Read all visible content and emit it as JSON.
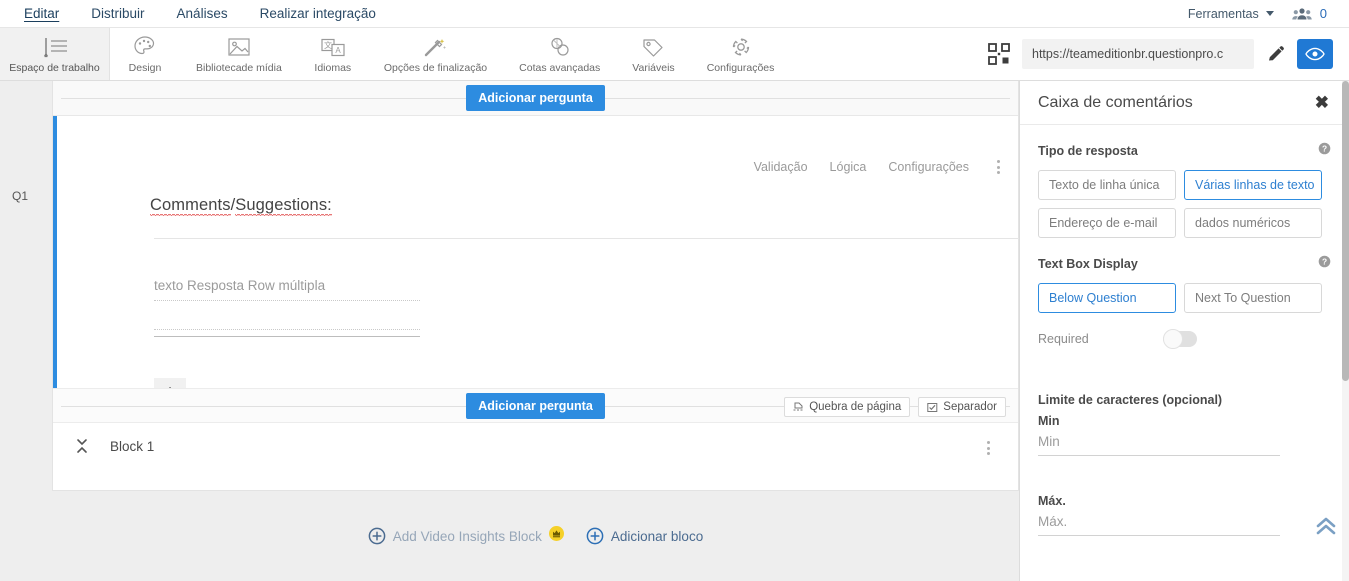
{
  "topnav": {
    "items": [
      {
        "label": "Editar",
        "active": true
      },
      {
        "label": "Distribuir",
        "active": false
      },
      {
        "label": "Análises",
        "active": false
      },
      {
        "label": "Realizar integração",
        "active": false
      }
    ],
    "tools_label": "Ferramentas",
    "collaborators_count": "0"
  },
  "toolbar": {
    "workspace_label": "Espaço de trabalho",
    "items": [
      {
        "label": "Design",
        "icon": "palette-icon"
      },
      {
        "label": "Bibliotecade mídia",
        "icon": "media-library-icon"
      },
      {
        "label": "Idiomas",
        "icon": "languages-icon"
      },
      {
        "label": "Opções de finalização",
        "icon": "magic-wand-icon"
      },
      {
        "label": "Cotas avançadas",
        "icon": "quotas-icon"
      },
      {
        "label": "Variáveis",
        "icon": "tag-icon"
      },
      {
        "label": "Configurações",
        "icon": "gear-icon"
      }
    ],
    "qr_icon": "qr-code-icon",
    "survey_url": "https://teameditionbr.questionpro.c",
    "edit_icon": "pencil-icon",
    "preview_icon": "eye-icon"
  },
  "canvas": {
    "question_number": "Q1",
    "add_question_top": "Adicionar pergunta",
    "add_question_bottom": "Adicionar pergunta",
    "question_tools": [
      "Validação",
      "Lógica",
      "Configurações"
    ],
    "question_title": "Comments/Suggestions:",
    "question_title_part1": "Comments",
    "question_title_sep": "/",
    "question_title_part2": "Suggestions:",
    "answer_rows": [
      {
        "value": "texto Resposta Row múltipla",
        "style": "dotted"
      },
      {
        "value": "",
        "style": "dotted"
      },
      {
        "value": "",
        "style": "solid"
      }
    ],
    "add_row_icon": "plus-icon",
    "page_break_label": "Quebra de página",
    "separator_label": "Separador",
    "block_name": "Block 1",
    "block_collapse_icon": "collapse-icon",
    "block_menu_icon": "kebab-menu-icon"
  },
  "block_actions": [
    {
      "label": "Add Video Insights Block",
      "icon": "plus-circle-icon",
      "badge": "premium-crown-badge",
      "muted": true
    },
    {
      "label": "Adicionar bloco",
      "icon": "plus-circle-icon",
      "badge": "",
      "muted": false
    }
  ],
  "right_panel": {
    "title": "Caixa de comentários",
    "close_icon": "close-icon",
    "response_type": {
      "label": "Tipo de resposta",
      "help_icon": "help-icon",
      "options": [
        {
          "label": "Texto de linha única",
          "selected": false
        },
        {
          "label": "Várias linhas de texto",
          "selected": true
        },
        {
          "label": "Endereço de e-mail",
          "selected": false
        },
        {
          "label": "dados numéricos",
          "selected": false
        }
      ]
    },
    "text_box_display": {
      "label": "Text Box Display",
      "help_icon": "help-icon",
      "options": [
        {
          "label": "Below Question",
          "selected": true
        },
        {
          "label": "Next To Question",
          "selected": false
        }
      ]
    },
    "required": {
      "label": "Required",
      "enabled": false
    },
    "character_limit": {
      "label": "Limite de caracteres (opcional)",
      "min_label": "Min",
      "min_placeholder": "Min",
      "min_value": "",
      "max_label": "Máx.",
      "max_placeholder": "Máx.",
      "max_value": ""
    },
    "scroll_top_icon": "chevron-double-up-icon"
  },
  "colors": {
    "accent_blue": "#2d8ce0",
    "nav_text": "#2b4a66",
    "panel_border": "#dcdcdc",
    "premium_yellow": "#f5d028"
  }
}
